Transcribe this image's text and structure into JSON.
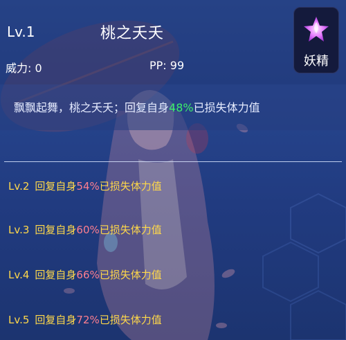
{
  "skill": {
    "level": "Lv.1",
    "name": "桃之夭夭",
    "power_label": "威力: 0",
    "pp_label": "PP: 99",
    "type": "妖精",
    "type_icon": "fairy-icon",
    "description": {
      "prefix": "飘飘起舞，桃之夭夭；回复自身",
      "percent": "48%",
      "suffix": "已损失体力值"
    }
  },
  "upgrades": [
    {
      "level": "Lv.2",
      "prefix": "回复自身",
      "percent": "54%",
      "suffix": "已损失体力值"
    },
    {
      "level": "Lv.3",
      "prefix": "回复自身",
      "percent": "60%",
      "suffix": "已损失体力值"
    },
    {
      "level": "Lv.4",
      "prefix": "回复自身",
      "percent": "66%",
      "suffix": "已损失体力值"
    },
    {
      "level": "Lv.5",
      "prefix": "回复自身",
      "percent": "72%",
      "suffix": "已损失体力值"
    }
  ],
  "colors": {
    "background": "#27468f",
    "highlight_green": "#3cf06a",
    "level_yellow": "#ffd84a",
    "percent_pink": "#ff7f8f"
  }
}
